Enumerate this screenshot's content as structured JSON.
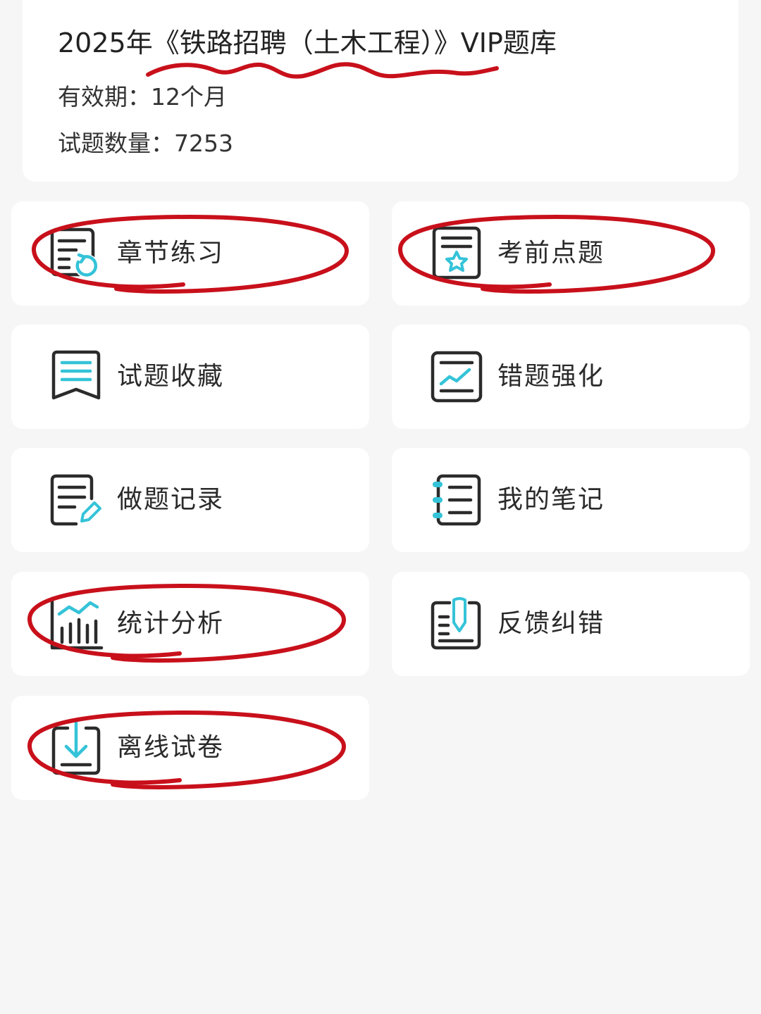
{
  "header": {
    "title": "2025年《铁路招聘（土木工程）》VIP题库",
    "validity": "有效期：12个月",
    "question_count": "试题数量：7253"
  },
  "menu": [
    {
      "label": "章节练习",
      "icon": "chapter-practice-icon"
    },
    {
      "label": "考前点题",
      "icon": "exam-tips-icon"
    },
    {
      "label": "试题收藏",
      "icon": "bookmark-icon"
    },
    {
      "label": "错题强化",
      "icon": "trend-icon"
    },
    {
      "label": "做题记录",
      "icon": "edit-record-icon"
    },
    {
      "label": "我的笔记",
      "icon": "notebook-icon"
    },
    {
      "label": "统计分析",
      "icon": "bar-chart-icon"
    },
    {
      "label": "反馈纠错",
      "icon": "feedback-icon"
    },
    {
      "label": "离线试卷",
      "icon": "download-icon"
    }
  ],
  "colors": {
    "icon_dark": "#2b2b2b",
    "icon_accent": "#34c3d8",
    "annotation_red": "#c8101b",
    "background": "#f6f6f6",
    "card": "#ffffff"
  }
}
